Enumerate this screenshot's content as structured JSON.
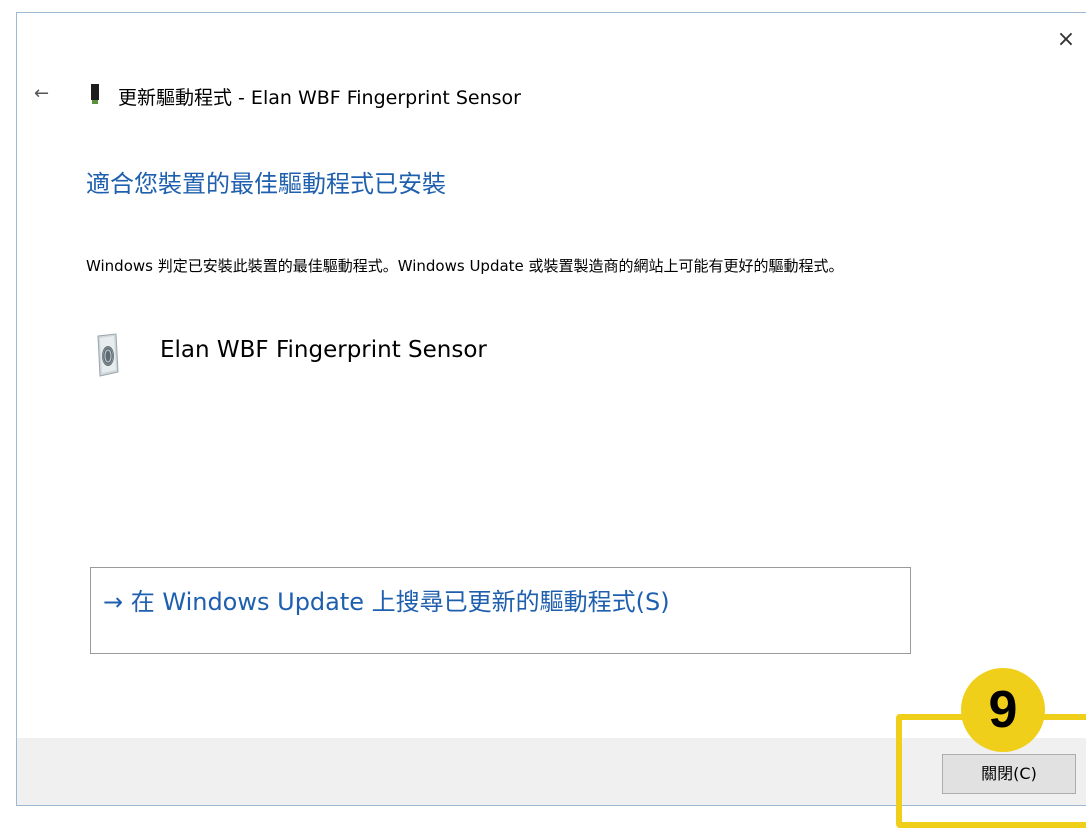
{
  "window": {
    "close_glyph": "×",
    "back_glyph": "←",
    "title": "更新驅動程式 - Elan WBF Fingerprint Sensor"
  },
  "main": {
    "heading": "適合您裝置的最佳驅動程式已安裝",
    "description": "Windows 判定已安裝此裝置的最佳驅動程式。Windows Update 或裝置製造商的網站上可能有更好的驅動程式。",
    "device_name": "Elan WBF Fingerprint Sensor",
    "update_link": "→ 在 Windows Update 上搜尋已更新的驅動程式(S)"
  },
  "footer": {
    "close_button_label": "關閉(C)"
  },
  "annotation": {
    "step_number": "9",
    "highlight_color": "#f0cf1a"
  },
  "icons": {
    "header_device": "usb-device-icon",
    "device": "fingerprint-sensor-icon"
  },
  "colors": {
    "link_blue": "#1e5fae",
    "footer_bg": "#f0f0f0"
  }
}
